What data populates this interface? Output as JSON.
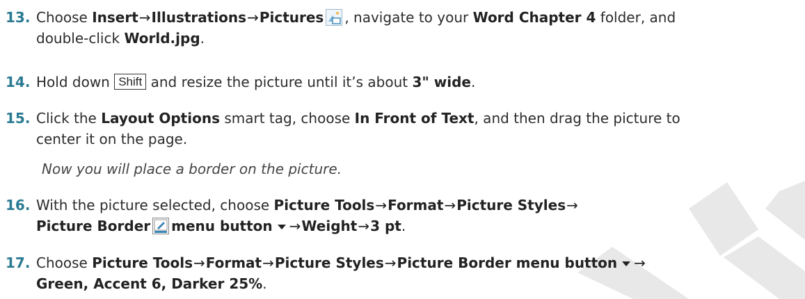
{
  "steps": [
    {
      "number": "13.",
      "lines": [
        {
          "t1": "Choose ",
          "b1": "Insert",
          "a1": "→",
          "b2": "Illustrations",
          "a2": "→",
          "b3": "Pictures",
          "t2": ", navigate to your ",
          "b4": "Word Chapter 4",
          "t3": " folder, and"
        },
        {
          "t1": "double-click ",
          "b1": "World.jpg",
          "t2": "."
        }
      ]
    },
    {
      "number": "14.",
      "lines": [
        {
          "t1": "Hold down ",
          "key": "Shift",
          "t2": " and resize the picture until it’s about ",
          "b1": "3\" wide",
          "t3": "."
        }
      ]
    },
    {
      "number": "15.",
      "lines": [
        {
          "t1": "Click the ",
          "b1": "Layout Options",
          "t2": " smart tag, choose ",
          "b2": "In Front of Text",
          "t3": ", and then drag the picture to"
        },
        {
          "t1": "center it on the page."
        }
      ]
    },
    {
      "note": "Now you will place a border on the picture."
    },
    {
      "number": "16.",
      "lines": [
        {
          "t1": "With the picture selected, choose ",
          "b1": "Picture Tools",
          "a1": "→",
          "b2": "Format",
          "a2": "→",
          "b3": "Picture Styles",
          "a3": "→"
        },
        {
          "b1": "Picture Border",
          "b2": "menu button",
          "a1": "→",
          "b3": "Weight",
          "a2": "→",
          "b4": "3 pt",
          "t1": "."
        }
      ]
    },
    {
      "number": "17.",
      "lines": [
        {
          "t1": "Choose ",
          "b1": "Picture Tools",
          "a1": "→",
          "b2": "Format",
          "a2": "→",
          "b3": "Picture Styles",
          "a3": "→",
          "b4": "Picture Border menu button",
          "a4": "→"
        },
        {
          "b1": "Green, Accent 6, Darker 25%",
          "t1": "."
        }
      ]
    }
  ],
  "icons": {
    "pictures": "pictures-icon",
    "picture_border": "picture-border-icon",
    "dropdown": "dropdown-arrow-icon"
  },
  "colors": {
    "step_number": "#2a7a91",
    "watermark": "#e6e6e6"
  }
}
